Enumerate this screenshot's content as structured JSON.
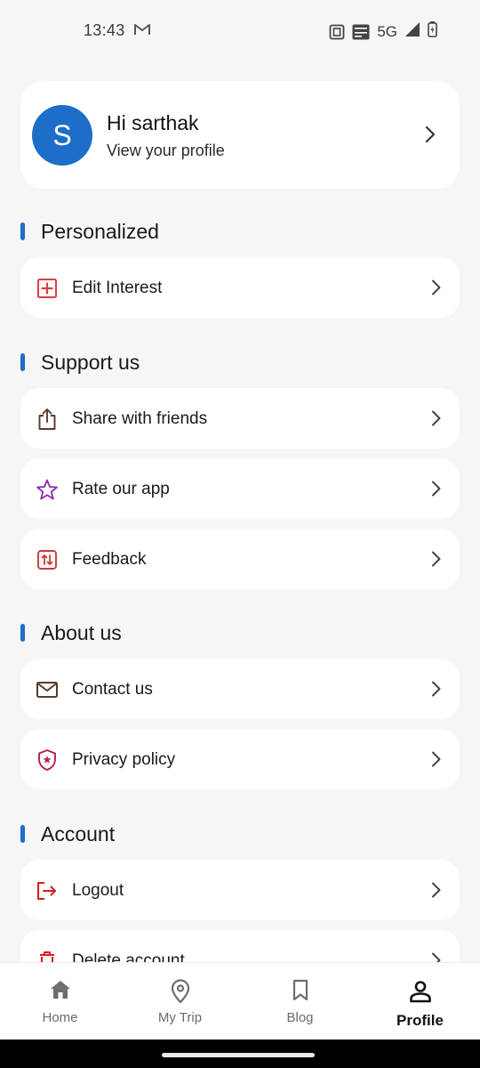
{
  "status_bar": {
    "time": "13:43",
    "network": "5G",
    "icons": [
      "gmail-icon",
      "nfc-icon",
      "volte-icon",
      "signal-icon",
      "battery-charging-icon"
    ]
  },
  "profile": {
    "avatar_initial": "S",
    "greeting": "Hi sarthak",
    "subtitle": "View your profile",
    "avatar_color": "#1d6ec8"
  },
  "sections": {
    "personalized": {
      "title": "Personalized",
      "items": [
        {
          "label": "Edit Interest",
          "icon": "add-box-icon"
        }
      ]
    },
    "support": {
      "title": "Support us",
      "items": [
        {
          "label": "Share with friends",
          "icon": "share-icon"
        },
        {
          "label": "Rate our app",
          "icon": "star-icon"
        },
        {
          "label": "Feedback",
          "icon": "feedback-icon"
        }
      ]
    },
    "about": {
      "title": "About us",
      "items": [
        {
          "label": "Contact us",
          "icon": "mail-icon"
        },
        {
          "label": "Privacy policy",
          "icon": "shield-icon"
        }
      ]
    },
    "account": {
      "title": "Account",
      "items": [
        {
          "label": "Logout",
          "icon": "logout-icon"
        },
        {
          "label": "Delete account",
          "icon": "trash-icon"
        }
      ]
    }
  },
  "bottom_nav": {
    "items": [
      {
        "label": "Home",
        "icon": "home-icon"
      },
      {
        "label": "My Trip",
        "icon": "location-pin-icon"
      },
      {
        "label": "Blog",
        "icon": "bookmark-icon"
      },
      {
        "label": "Profile",
        "icon": "person-icon",
        "active": true
      }
    ]
  },
  "colors": {
    "accent": "#1d6ec8",
    "background": "#f6f6f6",
    "card": "#ffffff"
  }
}
